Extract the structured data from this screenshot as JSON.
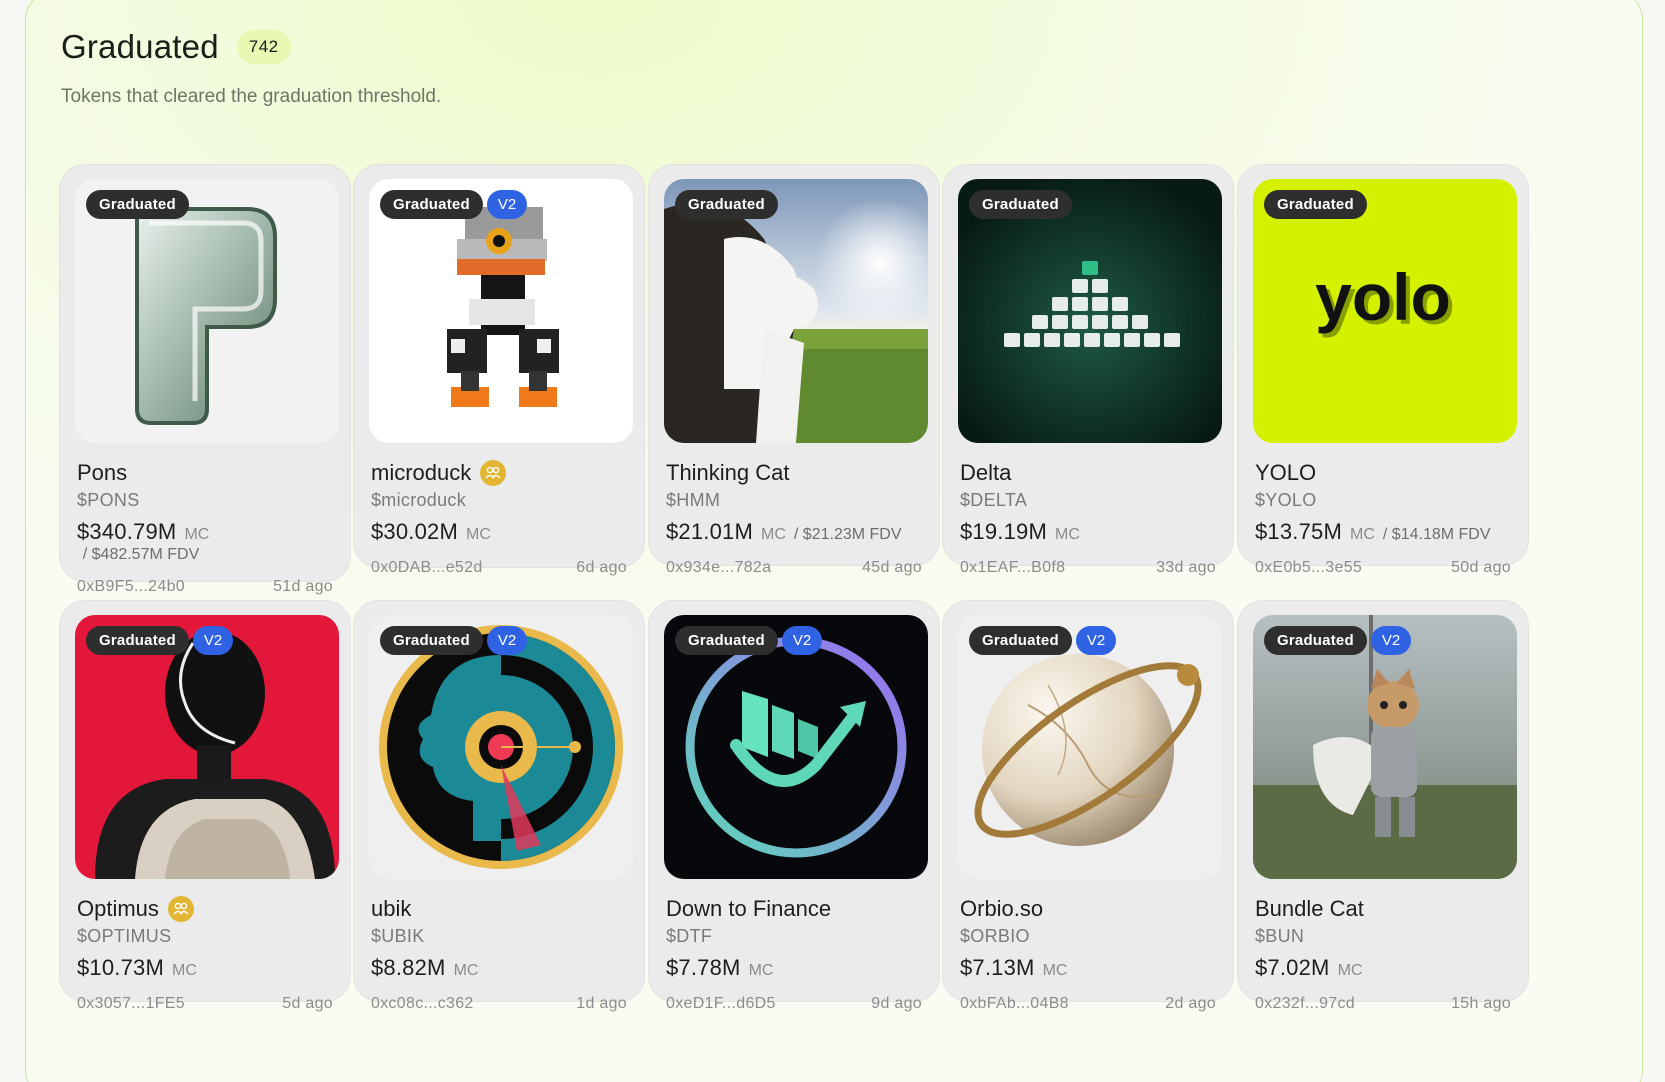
{
  "header": {
    "title": "Graduated",
    "count": "742",
    "subtitle": "Tokens that cleared the graduation threshold."
  },
  "badge_labels": {
    "graduated": "Graduated",
    "v2": "V2"
  },
  "colors": {
    "accent_lime": "#e8f8b2",
    "badge_dark": "#2e2e2e",
    "badge_v2": "#2f63e3",
    "community_gold": "#e2b632"
  },
  "tokens": [
    {
      "name": "Pons",
      "ticker": "$PONS",
      "mc": "$340.79M",
      "mc_label": "MC",
      "fdv": "/ $482.57M FDV",
      "address": "0xB9F5...24b0",
      "age": "51d ago",
      "v2": false,
      "community": false,
      "image": "glass-p-logo"
    },
    {
      "name": "microduck",
      "ticker": "$microduck",
      "mc": "$30.02M",
      "mc_label": "MC",
      "fdv": "",
      "address": "0x0DAB...e52d",
      "age": "6d ago",
      "v2": true,
      "community": true,
      "image": "pixel-duck-robot"
    },
    {
      "name": "Thinking Cat",
      "ticker": "$HMM",
      "mc": "$21.01M",
      "mc_label": "MC",
      "fdv": "/ $21.23M FDV",
      "address": "0x934e...782a",
      "age": "45d ago",
      "v2": false,
      "community": false,
      "image": "cat-photo"
    },
    {
      "name": "Delta",
      "ticker": "$DELTA",
      "mc": "$19.19M",
      "mc_label": "MC",
      "fdv": "",
      "address": "0x1EAF...B0f8",
      "age": "33d ago",
      "v2": false,
      "community": false,
      "image": "delta-pyramid"
    },
    {
      "name": "YOLO",
      "ticker": "$YOLO",
      "mc": "$13.75M",
      "mc_label": "MC",
      "fdv": "/ $14.18M FDV",
      "address": "0xE0b5...3e55",
      "age": "50d ago",
      "v2": false,
      "community": false,
      "image": "yolo-wordmark",
      "image_text": "yolo"
    },
    {
      "name": "Optimus",
      "ticker": "$OPTIMUS",
      "mc": "$10.73M",
      "mc_label": "MC",
      "fdv": "",
      "address": "0x3057...1FE5",
      "age": "5d ago",
      "v2": true,
      "community": true,
      "image": "robot-red"
    },
    {
      "name": "ubik",
      "ticker": "$UBIK",
      "mc": "$8.82M",
      "mc_label": "MC",
      "fdv": "",
      "address": "0xc08c...c362",
      "age": "1d ago",
      "v2": true,
      "community": false,
      "image": "profile-circle"
    },
    {
      "name": "Down to Finance",
      "ticker": "$DTF",
      "mc": "$7.78M",
      "mc_label": "MC",
      "fdv": "",
      "address": "0xeD1F...d6D5",
      "age": "9d ago",
      "v2": true,
      "community": false,
      "image": "dtf-logo"
    },
    {
      "name": "Orbio.so",
      "ticker": "$ORBIO",
      "mc": "$7.13M",
      "mc_label": "MC",
      "fdv": "",
      "address": "0xbFAb...04B8",
      "age": "2d ago",
      "v2": true,
      "community": false,
      "image": "marble-orb"
    },
    {
      "name": "Bundle Cat",
      "ticker": "$BUN",
      "mc": "$7.02M",
      "mc_label": "MC",
      "fdv": "",
      "address": "0x232f...97cd",
      "age": "15h ago",
      "v2": true,
      "community": false,
      "image": "knight-kitten"
    }
  ]
}
